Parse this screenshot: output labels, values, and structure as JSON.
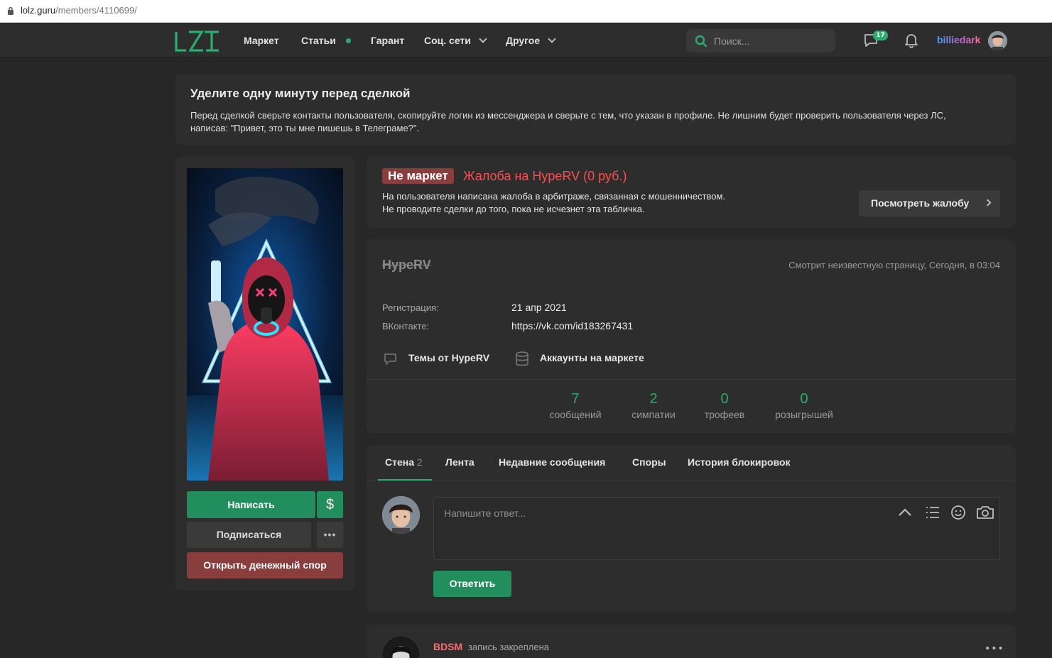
{
  "browser": {
    "url_host": "lolz.guru",
    "url_path": "/members/4110699/"
  },
  "header": {
    "logo": "LZT",
    "nav": [
      "Маркет",
      "Статьи",
      "Гарант",
      "Соц. сети",
      "Другое"
    ],
    "search_placeholder": "Поиск...",
    "messages_badge": "17",
    "username": "billiedark"
  },
  "notice": {
    "title": "Уделите одну минуту перед сделкой",
    "text": "Перед сделкой сверьте контакты пользователя, скопируйте логин из мессенджера и сверьте с тем, что указан в профиле. Не лишним будет проверить пользователя через ЛС, написав: \"Привет, это ты мне пишешь в Телеграме?\"."
  },
  "sidebar": {
    "write": "Написать",
    "dollar": "$",
    "subscribe": "Подписаться",
    "more": "•••",
    "dispute": "Открыть денежный спор"
  },
  "alert": {
    "tag": "Не маркет",
    "complaint": "Жалоба на HypeRV (0 руб.)",
    "line1": "На пользователя написана жалоба в арбитраже, связанная с мошенничеством.",
    "line2": "Не проводите сделки до того, пока не исчезнет эта табличка.",
    "view_button": "Посмотреть жалобу"
  },
  "profile": {
    "name": "HypeRV",
    "status": "Смотрит неизвестную страницу, Сегодня, в 03:04",
    "fields": [
      {
        "label": "Регистрация:",
        "value": "21 апр 2021"
      },
      {
        "label": "ВКонтакте:",
        "value": "https://vk.com/id183267431"
      }
    ],
    "links": [
      "Темы от HypeRV",
      "Аккаунты на маркете"
    ],
    "stats": [
      {
        "n": "7",
        "label": "сообщений"
      },
      {
        "n": "2",
        "label": "симпатии"
      },
      {
        "n": "0",
        "label": "трофеев"
      },
      {
        "n": "0",
        "label": "розыгрышей"
      }
    ]
  },
  "wall": {
    "tabs": [
      {
        "label": "Стена",
        "count": "2"
      },
      {
        "label": "Лента"
      },
      {
        "label": "Недавние сообщения"
      },
      {
        "label": "Споры"
      },
      {
        "label": "История блокировок"
      }
    ],
    "reply_placeholder": "Напишите ответ...",
    "reply_button": "Ответить"
  },
  "post": {
    "author": "BDSM",
    "note": "запись закреплена",
    "more": "•••"
  },
  "colors": {
    "accent": "#2bad72",
    "danger": "#ff4c4c",
    "panel": "#2d2d2d",
    "bg": "#272727"
  }
}
